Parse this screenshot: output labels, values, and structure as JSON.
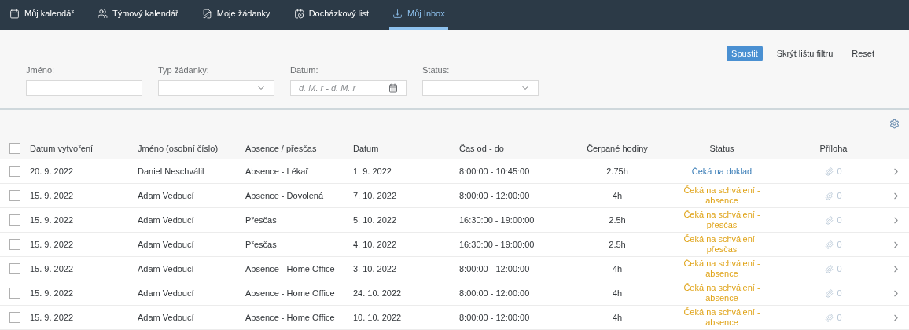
{
  "tabs": [
    {
      "label": "Můj kalendář",
      "selected": false
    },
    {
      "label": "Týmový kalendář",
      "selected": false
    },
    {
      "label": "Moje žádanky",
      "selected": false
    },
    {
      "label": "Docházkový list",
      "selected": false
    },
    {
      "label": "Můj Inbox",
      "selected": true
    }
  ],
  "filter": {
    "fields": [
      {
        "label": "Jméno:",
        "kind": "text"
      },
      {
        "label": "Typ žádanky:",
        "kind": "select"
      },
      {
        "label": "Datum:",
        "kind": "date",
        "placeholder": "d. M. r - d. M. r"
      },
      {
        "label": "Status:",
        "kind": "select"
      }
    ],
    "buttons": [
      {
        "label": "Spustit",
        "kind": "primary"
      },
      {
        "label": "Skrýt lištu filtru",
        "kind": "plain"
      },
      {
        "label": "Reset",
        "kind": "plain"
      }
    ]
  },
  "table": {
    "columns": [
      "Datum vytvoření",
      "Jméno (osobní číslo)",
      "Absence / přesčas",
      "Datum",
      "Čas od - do",
      "Čerpané hodiny",
      "Status",
      "Příloha"
    ],
    "all_checked": false,
    "rows": [
      {
        "checked": false,
        "created": "20. 9. 2022",
        "name": "Daniel Neschválil",
        "type": "Absence - Lékař",
        "date": "1. 9. 2022",
        "time": "8:00:00 - 10:45:00",
        "hours": "2.75h",
        "status": "Čeká na doklad",
        "color": "#3d7fb8",
        "attachments": "0"
      },
      {
        "checked": false,
        "created": "15. 9. 2022",
        "name": "Adam Vedoucí",
        "type": "Absence - Dovolená",
        "date": "7. 10. 2022",
        "time": "8:00:00 - 12:00:00",
        "hours": "4h",
        "status": "Čeká na schválení - absence",
        "color": "#e0a419",
        "attachments": "0"
      },
      {
        "checked": false,
        "created": "15. 9. 2022",
        "name": "Adam Vedoucí",
        "type": "Přesčas",
        "date": "5. 10. 2022",
        "time": "16:30:00 - 19:00:00",
        "hours": "2.5h",
        "status": "Čeká na schválení - přesčas",
        "color": "#e0a419",
        "attachments": "0"
      },
      {
        "checked": false,
        "created": "15. 9. 2022",
        "name": "Adam Vedoucí",
        "type": "Přesčas",
        "date": "4. 10. 2022",
        "time": "16:30:00 - 19:00:00",
        "hours": "2.5h",
        "status": "Čeká na schválení - přesčas",
        "color": "#e0a419",
        "attachments": "0"
      },
      {
        "checked": false,
        "created": "15. 9. 2022",
        "name": "Adam Vedoucí",
        "type": "Absence - Home Office",
        "date": "3. 10. 2022",
        "time": "8:00:00 - 12:00:00",
        "hours": "4h",
        "status": "Čeká na schválení - absence",
        "color": "#e0a419",
        "attachments": "0"
      },
      {
        "checked": false,
        "created": "15. 9. 2022",
        "name": "Adam Vedoucí",
        "type": "Absence - Home Office",
        "date": "24. 10. 2022",
        "time": "8:00:00 - 12:00:00",
        "hours": "4h",
        "status": "Čeká na schválení - absence",
        "color": "#e0a419",
        "attachments": "0"
      },
      {
        "checked": false,
        "created": "15. 9. 2022",
        "name": "Adam Vedoucí",
        "type": "Absence - Home Office",
        "date": "10. 10. 2022",
        "time": "8:00:00 - 12:00:00",
        "hours": "4h",
        "status": "Čeká na schválení - absence",
        "color": "#e0a419",
        "attachments": "0"
      }
    ]
  }
}
